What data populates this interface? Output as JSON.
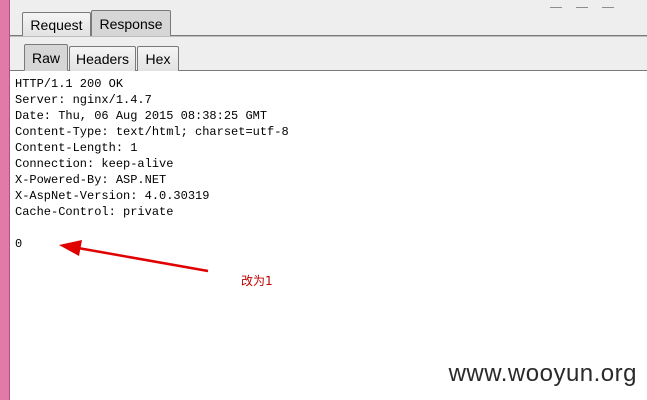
{
  "tabs": {
    "outer": [
      "Request",
      "Response"
    ],
    "outer_selected": "Response",
    "inner": [
      "Raw",
      "Headers",
      "Hex"
    ],
    "inner_selected": "Raw"
  },
  "response": {
    "lines": [
      "HTTP/1.1 200 OK",
      "Server: nginx/1.4.7",
      "Date: Thu, 06 Aug 2015 08:38:25 GMT",
      "Content-Type: text/html; charset=utf-8",
      "Content-Length: 1",
      "Connection: keep-alive",
      "X-Powered-By: ASP.NET",
      "X-AspNet-Version: 4.0.30319",
      "Cache-Control: private",
      "",
      "0"
    ]
  },
  "annotation": {
    "text": "改为1",
    "color": "#e00000"
  },
  "watermark": "www.wooyun.org",
  "colors": {
    "left_bar": "#e07aa6",
    "tab_selected": "#d6d6d6",
    "arrow": "#e00000"
  }
}
